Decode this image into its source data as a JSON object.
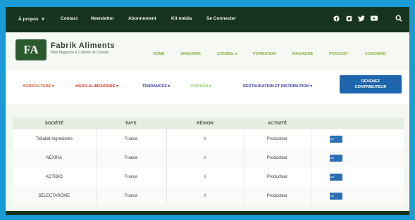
{
  "topbar": {
    "items": [
      {
        "label": "À propos",
        "chevron": "▾"
      },
      {
        "label": "Contact"
      },
      {
        "label": "Newsletter"
      },
      {
        "label": "Abonnement"
      },
      {
        "label": "Kit média"
      },
      {
        "label": "Se Connecter"
      }
    ],
    "social_icons": [
      "facebook-icon",
      "instagram-icon",
      "twitter-icon",
      "youtube-icon"
    ],
    "search_icon": "search-icon"
  },
  "header": {
    "logo_text": "FA",
    "brand_name": "Fabrik Aliments",
    "tagline": "Web Magazine & Cabinet de Conseil",
    "nav": [
      {
        "label": "HOME"
      },
      {
        "label": "ANNUAIRE"
      },
      {
        "label": "CONSEIL ▾"
      },
      {
        "label": "FORMATION"
      },
      {
        "label": "MAGAZINE"
      },
      {
        "label": "PODCAST"
      },
      {
        "label": "COACHING"
      }
    ]
  },
  "categories": [
    {
      "label": "AGRICULTURE ▾",
      "color": "#e8542b"
    },
    {
      "label": "AGRO-ALIMENTAIRE ▾",
      "color": "#d9372b"
    },
    {
      "label": "TENDANCES ▾",
      "color": "#3a3f9e"
    },
    {
      "label": "CUISSON ▾",
      "color": "#8fd36a"
    },
    {
      "label": "RESTAURATION ET DISTRIBUTION ▾",
      "color": "#3a3f9e"
    }
  ],
  "cta": {
    "line1": "DEVENEZ",
    "line2": "CONTRIBUTEUR"
  },
  "table": {
    "headers": [
      "SOCIÉTÉ",
      "PAYS",
      "RÉGION",
      "ACTIVITÉ",
      ""
    ],
    "rows": [
      {
        "societe": "Triballat Ingredients",
        "pays": "France",
        "region": "//",
        "activite": "Producteur",
        "link": "Link"
      },
      {
        "societe": "NEXIRA",
        "pays": "France",
        "region": "//",
        "activite": "Producteur",
        "link": "Link"
      },
      {
        "societe": "ACTIBIO",
        "pays": "France",
        "region": "//",
        "activite": "Producteur",
        "link": "Link"
      },
      {
        "societe": "SÉLECTARÔME",
        "pays": "France",
        "region": "//",
        "activite": "Producteur",
        "link": "Link"
      }
    ]
  }
}
